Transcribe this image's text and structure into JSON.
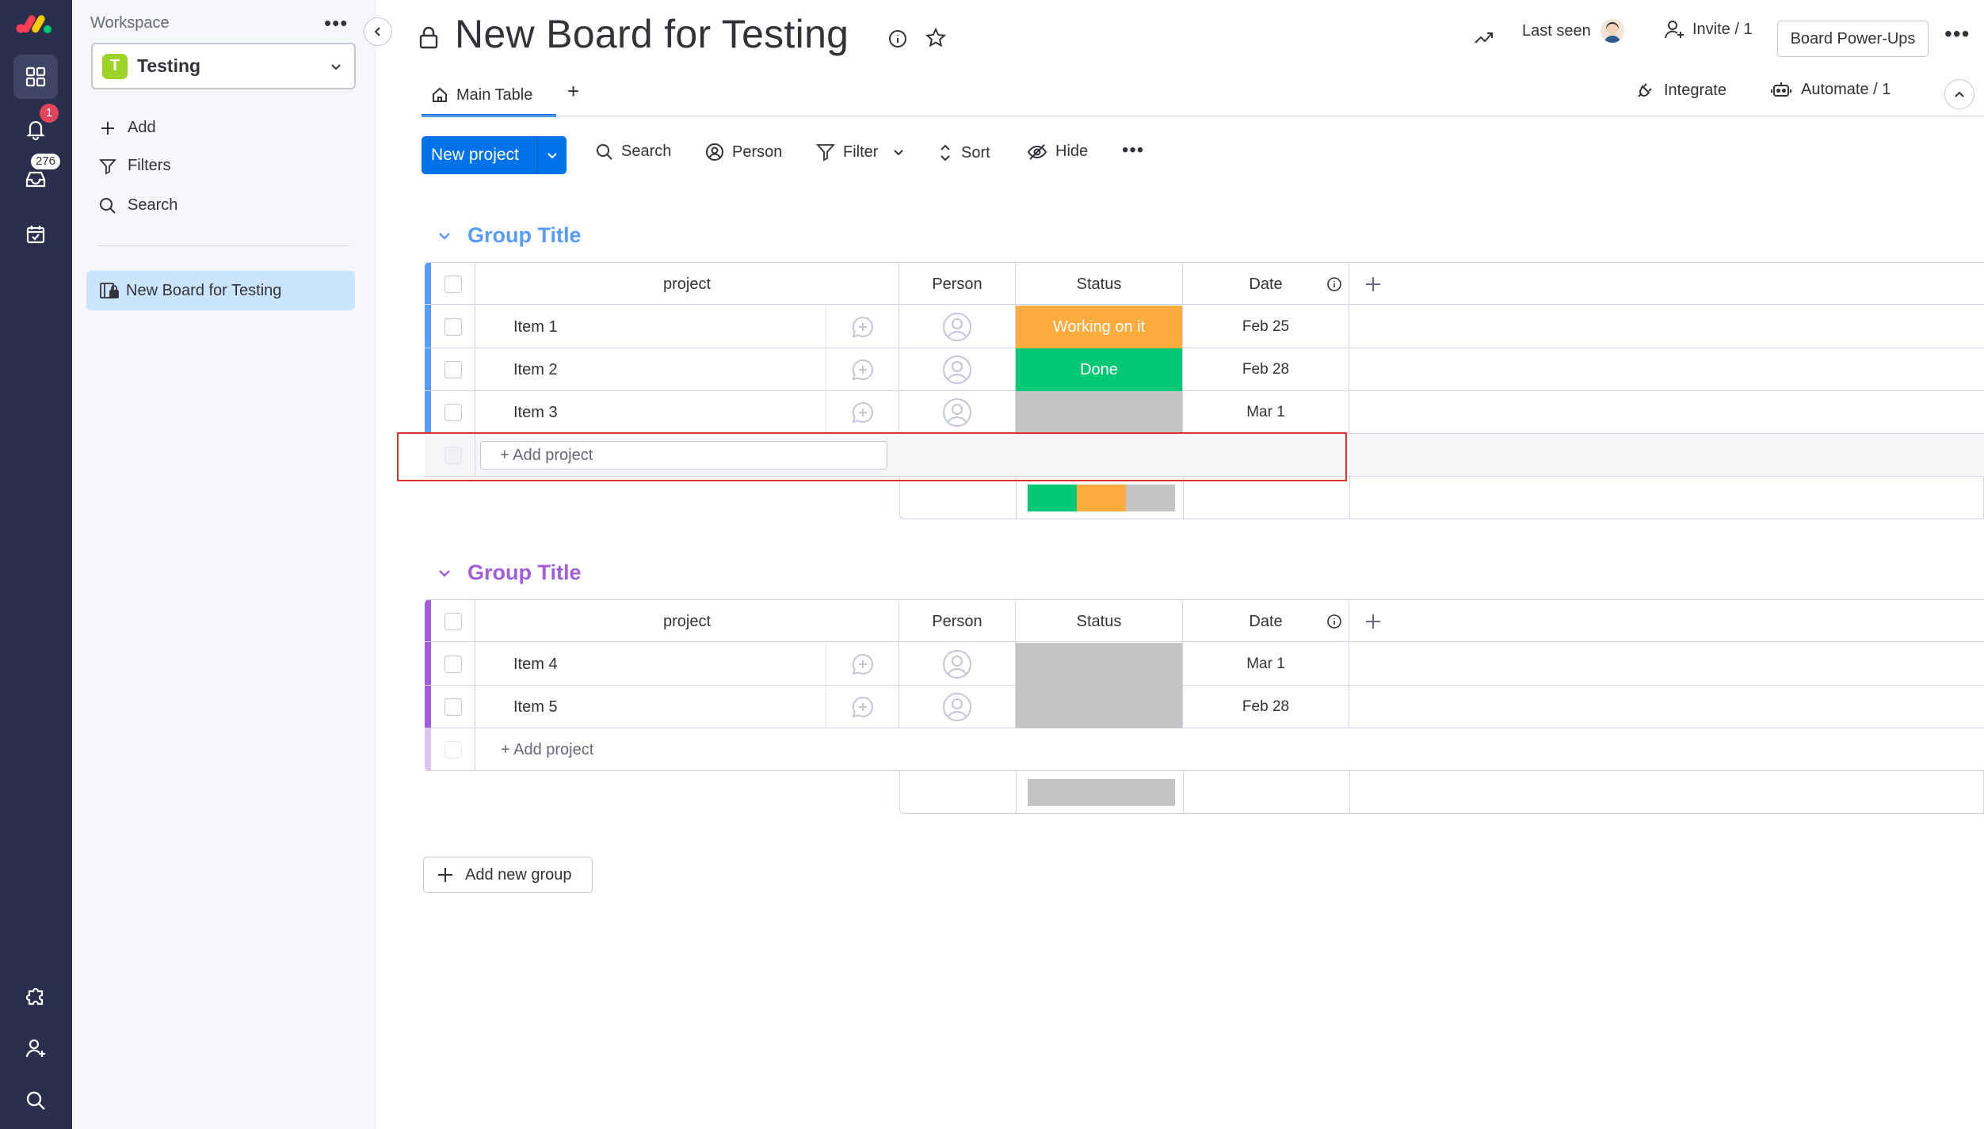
{
  "rail": {
    "notifications_badge": "1",
    "inbox_badge": "276"
  },
  "sidebar": {
    "workspace_label": "Workspace",
    "workspace_logo_letter": "T",
    "workspace_name": "Testing",
    "actions": {
      "add": "Add",
      "filters": "Filters",
      "search": "Search"
    },
    "boards": [
      "New Board for Testing"
    ]
  },
  "header": {
    "title": "New Board for Testing",
    "last_seen": "Last seen",
    "invite": "Invite / 1",
    "power_ups": "Board Power-Ups",
    "tab_main": "Main Table",
    "tab_add": "+",
    "integrate": "Integrate",
    "automate": "Automate / 1"
  },
  "toolbar": {
    "new_project": "New project",
    "search": "Search",
    "person": "Person",
    "filter": "Filter",
    "sort": "Sort",
    "hide": "Hide"
  },
  "columns": {
    "project": "project",
    "person": "Person",
    "status": "Status",
    "date": "Date"
  },
  "colors": {
    "group1": "#579bfc",
    "group2": "#a25ddc",
    "working": "#fdab3d",
    "done": "#00c875",
    "empty": "#c4c4c4",
    "primary": "#0073ea"
  },
  "groups": [
    {
      "title": "Group Title",
      "add_label": "+ Add project",
      "items": [
        {
          "name": "Item 1",
          "status": "Working on it",
          "date": "Feb 25"
        },
        {
          "name": "Item 2",
          "status": "Done",
          "date": "Feb 28"
        },
        {
          "name": "Item 3",
          "status": "",
          "date": "Mar 1"
        }
      ]
    },
    {
      "title": "Group Title",
      "add_label": "+ Add project",
      "items": [
        {
          "name": "Item 4",
          "status": "",
          "date": "Mar 1"
        },
        {
          "name": "Item 5",
          "status": "",
          "date": "Feb 28"
        }
      ]
    }
  ],
  "add_new_group": "Add new group"
}
